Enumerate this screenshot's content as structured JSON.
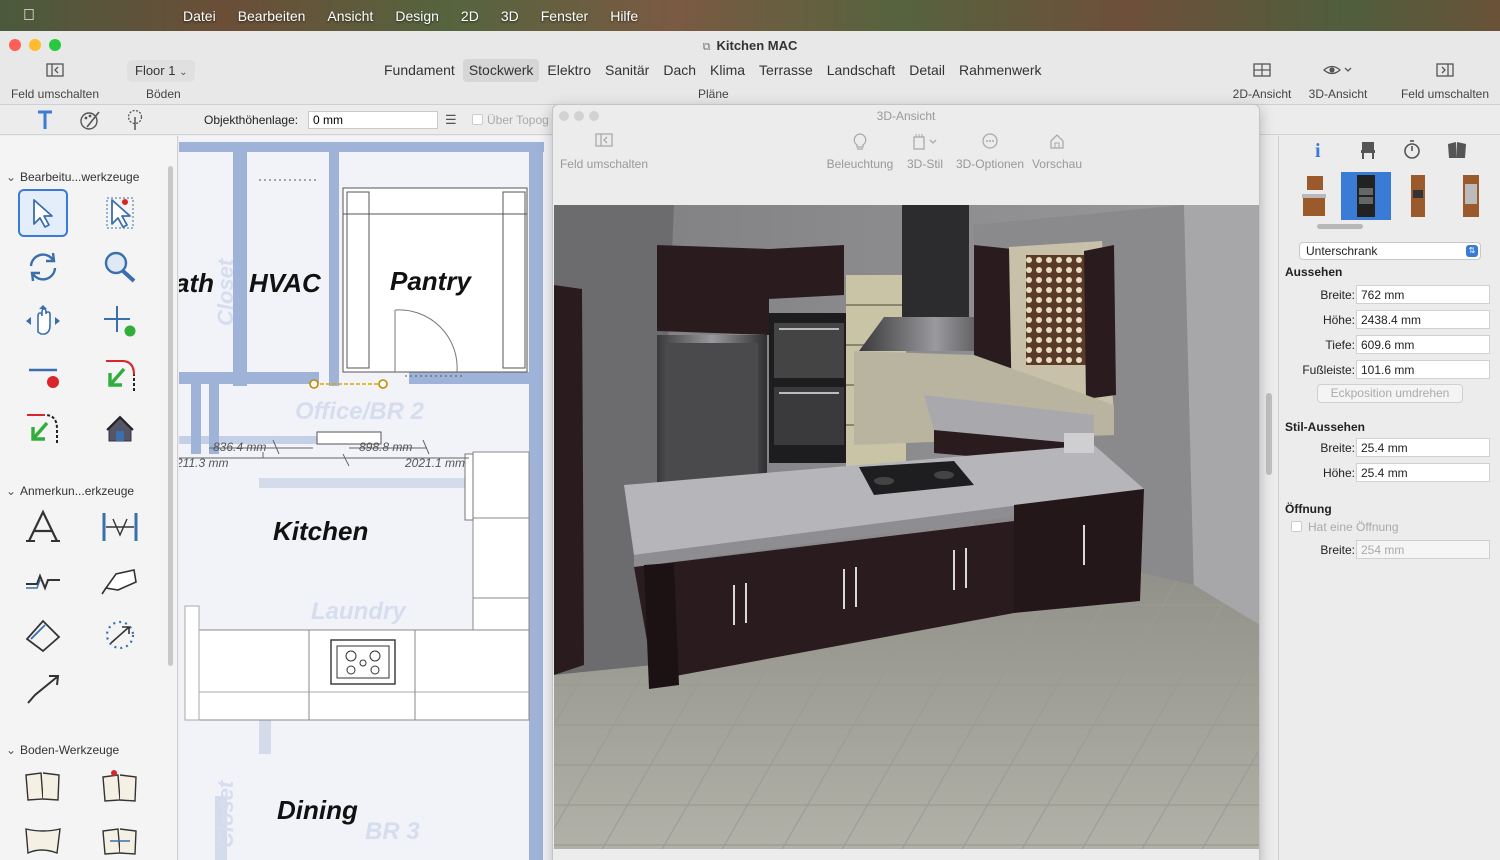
{
  "menubar": {
    "items": [
      "Datei",
      "Bearbeiten",
      "Ansicht",
      "Design",
      "2D",
      "3D",
      "Fenster",
      "Hilfe"
    ]
  },
  "window": {
    "title": "Kitchen MAC"
  },
  "toolbar": {
    "toggle_left_label": "Feld umschalten",
    "floor_value": "Floor 1",
    "floors_label": "Böden",
    "plan_tabs": [
      "Fundament",
      "Stockwerk",
      "Elektro",
      "Sanitär",
      "Dach",
      "Klima",
      "Terrasse",
      "Landschaft",
      "Detail",
      "Rahmenwerk"
    ],
    "active_tab": "Stockwerk",
    "plans_label": "Pläne",
    "view2d_label": "2D-Ansicht",
    "view3d_label": "3D-Ansicht",
    "toggle_right_label": "Feld umschalten"
  },
  "subbar": {
    "height_label": "Objekthöhenlage:",
    "height_value": "0 mm",
    "topo_label": "Über Topog"
  },
  "palette": {
    "sections": [
      {
        "title": "Bearbeitu...werkzeuge"
      },
      {
        "title": "Anmerkun...erkzeuge"
      },
      {
        "title": "Boden-Werkzeuge"
      }
    ]
  },
  "plan": {
    "rooms": {
      "bath": "ath",
      "hvac": "HVAC",
      "pantry": "Pantry",
      "kitchen": "Kitchen",
      "dining": "Dining"
    },
    "ghost_labels": {
      "closet_top": "Closet",
      "office": "Office/BR 2",
      "laundry": "Laundry",
      "closet_bottom": "Closet",
      "br3": "BR 3"
    },
    "dimensions": [
      "836.4 mm",
      "898.8 mm",
      "211.3 mm",
      "2021.1 mm"
    ]
  },
  "view3d": {
    "title": "3D-Ansicht",
    "toggle_label": "Feld umschalten",
    "buttons": [
      "Beleuchtung",
      "3D-Stil",
      "3D-Optionen",
      "Vorschau"
    ]
  },
  "inspector": {
    "type_value": "Unterschrank",
    "appearance": {
      "title": "Aussehen",
      "width_label": "Breite:",
      "width_value": "762 mm",
      "height_label": "Höhe:",
      "height_value": "2438.4 mm",
      "depth_label": "Tiefe:",
      "depth_value": "609.6 mm",
      "kick_label": "Fußleiste:",
      "kick_value": "101.6 mm",
      "flip_label": "Eckposition umdrehen"
    },
    "style": {
      "title": "Stil-Aussehen",
      "width_label": "Breite:",
      "width_value": "25.4 mm",
      "height_label": "Höhe:",
      "height_value": "25.4 mm"
    },
    "opening": {
      "title": "Öffnung",
      "has_label": "Hat eine Öffnung",
      "width_label": "Breite:",
      "width_value": "254 mm"
    }
  },
  "colors": {
    "accent": "#3a7bd5",
    "wall": "#9fb2d8",
    "cabinet": "#2a1c1e",
    "countertop": "#a9a9ad"
  }
}
